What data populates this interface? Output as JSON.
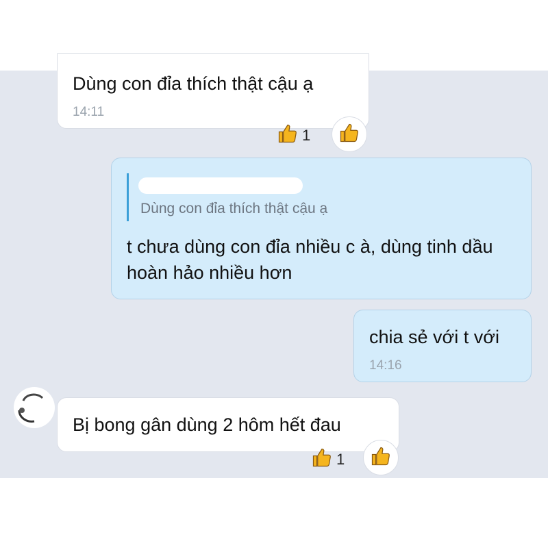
{
  "messages": [
    {
      "text": "Dùng con đỉa thích thật cậu ạ",
      "time": "14:11",
      "reaction_count": "1"
    },
    {
      "quote_text": "Dùng con đỉa thích thật cậu ạ",
      "text": "t chưa dùng con đỉa nhiều c à, dùng tinh dầu hoàn hảo nhiều hơn"
    },
    {
      "text": "chia sẻ với t với",
      "time": "14:16"
    },
    {
      "text": "Bị bong gân dùng 2 hôm hết đau",
      "reaction_count": "1"
    }
  ],
  "icons": {
    "reaction": "thumbs-up-icon",
    "react_button": "thumbs-up-icon"
  },
  "colors": {
    "background": "#e3e7ef",
    "incoming": "#ffffff",
    "outgoing": "#d4ecfb",
    "quote_bar": "#3b9fd8",
    "thumb": "#f5b51e"
  }
}
